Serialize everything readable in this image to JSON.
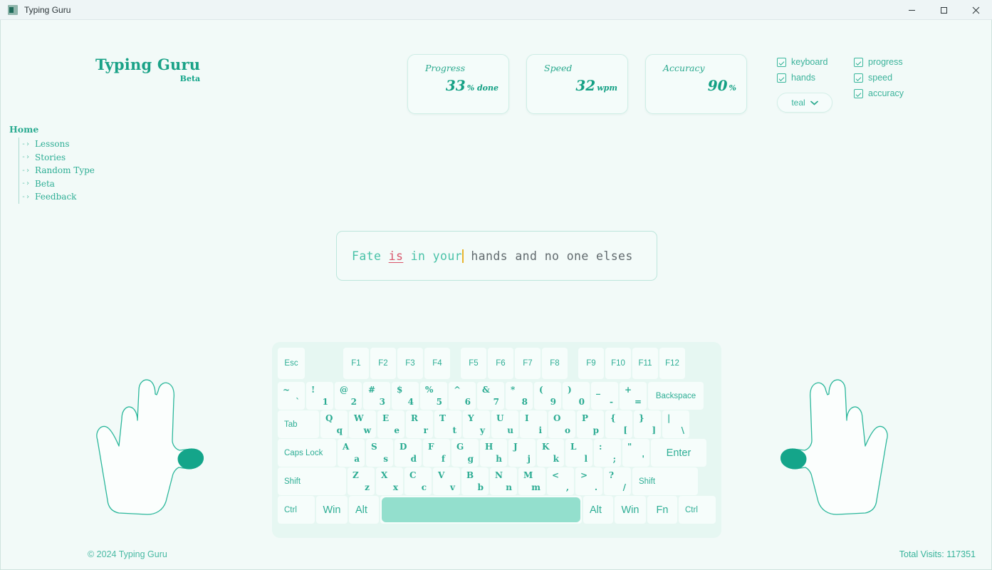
{
  "window": {
    "title": "Typing Guru",
    "icon": "app-icon",
    "minimize_label": "Minimize",
    "maximize_label": "Maximize",
    "close_label": "Close"
  },
  "brand": {
    "name": "Typing Guru",
    "tag": "Beta"
  },
  "theme": {
    "accent": "#14a58a",
    "accent_light": "#49c2a8",
    "error": "#d9546a",
    "caret": "#e8b42c",
    "background": "#f2faf8",
    "key_face": "#f6fdfb",
    "keyboard_bg": "#e6f7f2"
  },
  "stats": [
    {
      "label": "Progress",
      "value": "33",
      "unit": "% done"
    },
    {
      "label": "Speed",
      "value": "32",
      "unit": "wpm"
    },
    {
      "label": "Accuracy",
      "value": "90",
      "unit": "%"
    }
  ],
  "toggles": {
    "column_one": [
      {
        "label": "keyboard",
        "checked": true
      },
      {
        "label": "hands",
        "checked": true
      }
    ],
    "column_two": [
      {
        "label": "progress",
        "checked": true
      },
      {
        "label": "speed",
        "checked": true
      },
      {
        "label": "accuracy",
        "checked": true
      }
    ],
    "theme_select": {
      "value": "teal",
      "icon": "chevron-down-icon"
    }
  },
  "nav": {
    "root": "Home",
    "items": [
      {
        "label": "Lessons",
        "arrow": "-›"
      },
      {
        "label": "Stories",
        "arrow": "-›"
      },
      {
        "label": "Random Type",
        "arrow": "-›"
      },
      {
        "label": "Beta",
        "arrow": "-›"
      },
      {
        "label": "Feedback",
        "arrow": "-›"
      }
    ]
  },
  "typing": {
    "typed_correct_1": "Fate ",
    "typed_error": "is",
    "typed_correct_2": " in your",
    "remaining": " hands and no one elses",
    "full_text": "Fate is in your hands and no one elses"
  },
  "hands": {
    "left_label": "left-hand-guide",
    "right_label": "right-hand-guide",
    "highlighted_finger": "thumb"
  },
  "keyboard": {
    "next_key": "Space",
    "rows": {
      "function": [
        {
          "label": "Esc",
          "cls": "esc"
        },
        {
          "spacer": "lg"
        },
        {
          "label": "F1",
          "cls": "fnk"
        },
        {
          "label": "F2",
          "cls": "fnk"
        },
        {
          "label": "F3",
          "cls": "fnk"
        },
        {
          "label": "F4",
          "cls": "fnk"
        },
        {
          "spacer": "sm"
        },
        {
          "label": "F5",
          "cls": "fnk"
        },
        {
          "label": "F6",
          "cls": "fnk"
        },
        {
          "label": "F7",
          "cls": "fnk"
        },
        {
          "label": "F8",
          "cls": "fnk"
        },
        {
          "spacer": "sm"
        },
        {
          "label": "F9",
          "cls": "fnk"
        },
        {
          "label": "F10",
          "cls": "fnk"
        },
        {
          "label": "F11",
          "cls": "fnk"
        },
        {
          "label": "F12",
          "cls": "fnk"
        }
      ],
      "numbers": [
        {
          "up": "~",
          "lo": "`"
        },
        {
          "up": "!",
          "lo": "1"
        },
        {
          "up": "@",
          "lo": "2"
        },
        {
          "up": "#",
          "lo": "3"
        },
        {
          "up": "$",
          "lo": "4"
        },
        {
          "up": "%",
          "lo": "5"
        },
        {
          "up": "^",
          "lo": "6"
        },
        {
          "up": "&",
          "lo": "7"
        },
        {
          "up": "*",
          "lo": "8"
        },
        {
          "up": "(",
          "lo": "9"
        },
        {
          "up": ")",
          "lo": "0"
        },
        {
          "up": "_",
          "lo": "-"
        },
        {
          "up": "+",
          "lo": "="
        },
        {
          "label": "Backspace",
          "cls": "back"
        }
      ],
      "qwerty": [
        {
          "label": "Tab",
          "cls": "tab"
        },
        {
          "up": "Q",
          "lo": "q"
        },
        {
          "up": "W",
          "lo": "w"
        },
        {
          "up": "E",
          "lo": "e"
        },
        {
          "up": "R",
          "lo": "r"
        },
        {
          "up": "T",
          "lo": "t"
        },
        {
          "up": "Y",
          "lo": "y"
        },
        {
          "up": "U",
          "lo": "u"
        },
        {
          "up": "I",
          "lo": "i"
        },
        {
          "up": "O",
          "lo": "o"
        },
        {
          "up": "P",
          "lo": "p"
        },
        {
          "up": "{",
          "lo": "["
        },
        {
          "up": "}",
          "lo": "]"
        },
        {
          "up": "|",
          "lo": "\\"
        }
      ],
      "home": [
        {
          "label": "Caps Lock",
          "cls": "caps"
        },
        {
          "up": "A",
          "lo": "a"
        },
        {
          "up": "S",
          "lo": "s"
        },
        {
          "up": "D",
          "lo": "d"
        },
        {
          "up": "F",
          "lo": "f"
        },
        {
          "up": "G",
          "lo": "g"
        },
        {
          "up": "H",
          "lo": "h"
        },
        {
          "up": "J",
          "lo": "j"
        },
        {
          "up": "K",
          "lo": "k"
        },
        {
          "up": "L",
          "lo": "l"
        },
        {
          "up": ":",
          "lo": ";"
        },
        {
          "up": "\"",
          "lo": "'"
        },
        {
          "label": "Enter",
          "cls": "enter big"
        }
      ],
      "bottom_letters": [
        {
          "label": "Shift",
          "cls": "shiftL"
        },
        {
          "up": "Z",
          "lo": "z"
        },
        {
          "up": "X",
          "lo": "x"
        },
        {
          "up": "C",
          "lo": "c"
        },
        {
          "up": "V",
          "lo": "v"
        },
        {
          "up": "B",
          "lo": "b"
        },
        {
          "up": "N",
          "lo": "n"
        },
        {
          "up": "M",
          "lo": "m"
        },
        {
          "up": "<",
          "lo": ","
        },
        {
          "up": ">",
          "lo": "."
        },
        {
          "up": "?",
          "lo": "/"
        },
        {
          "label": "Shift",
          "cls": "shiftR"
        }
      ],
      "modifiers": [
        {
          "label": "Ctrl",
          "cls": "ctrl"
        },
        {
          "label": "Win",
          "cls": "win big"
        },
        {
          "label": "Alt",
          "cls": "alt big"
        },
        {
          "label": "",
          "cls": "space",
          "active": true
        },
        {
          "label": "Alt",
          "cls": "alt big"
        },
        {
          "label": "Win",
          "cls": "win big"
        },
        {
          "label": "Fn",
          "cls": "alt big"
        },
        {
          "label": "Ctrl",
          "cls": "ctrl"
        }
      ]
    }
  },
  "footer": {
    "copyright": "© 2024 Typing Guru",
    "visits": "Total Visits: 117351"
  }
}
